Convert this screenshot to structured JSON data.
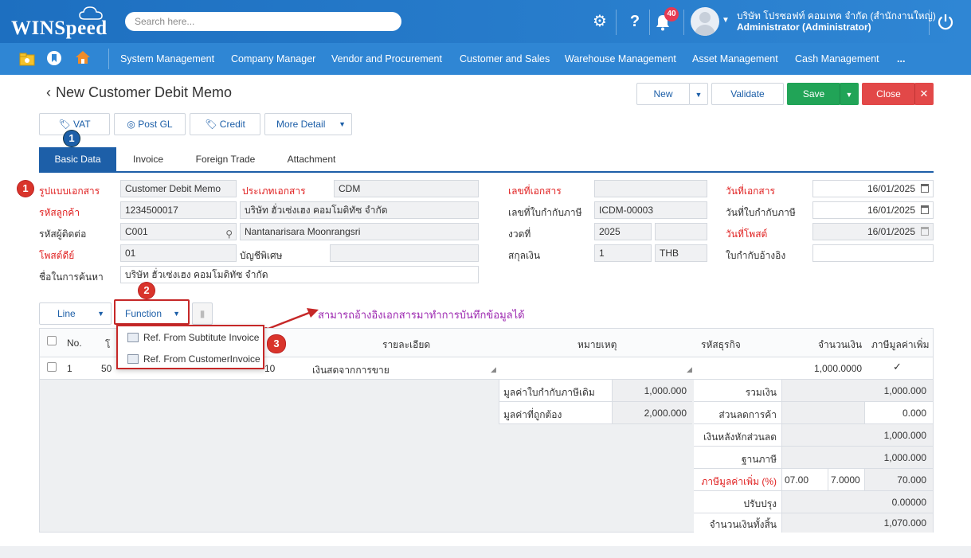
{
  "app": {
    "logo": "WINSpeed",
    "search_placeholder": "Search here...",
    "notifications_count": "40",
    "company": "บริษัท โปรซอฟท์ คอมเทค จำกัด (สำนักงานใหญ่)",
    "role": "Administrator (Administrator)"
  },
  "nav": {
    "items": [
      "System Management",
      "Company Manager",
      "Vendor and Procurement",
      "Customer and Sales",
      "Warehouse Management",
      "Asset Management",
      "Cash Management",
      "..."
    ]
  },
  "page": {
    "title": "New Customer Debit Memo",
    "back_icon": "chevron-left-icon"
  },
  "toolbar": {
    "new": "New",
    "validate": "Validate",
    "save": "Save",
    "close": "Close",
    "vat": "VAT",
    "post_gl": "Post GL",
    "credit": "Credit",
    "more_detail": "More Detail"
  },
  "tabs": [
    "Basic Data",
    "Invoice",
    "Foreign Trade",
    "Attachment"
  ],
  "form": {
    "doc_format_label": "รูปแบบเอกสาร",
    "doc_format_value": "Customer Debit Memo",
    "doc_type_label": "ประเภทเอกสาร",
    "doc_type_value": "CDM",
    "doc_no_label": "เลขที่เอกสาร",
    "doc_no_value": "",
    "doc_date_label": "วันที่เอกสาร",
    "doc_date_value": "16/01/2025",
    "customer_code_label": "รหัสลูกค้า",
    "customer_code_value": "1234500017",
    "customer_name_value": "บริษัท ฮั่วเซ่งเฮง คอมโมดิทัซ จำกัด",
    "tax_invoice_no_label": "เลขที่ใบกำกับภาษี",
    "tax_invoice_no_value": "ICDM-00003",
    "tax_invoice_date_label": "วันที่ใบกำกับภาษี",
    "tax_invoice_date_value": "16/01/2025",
    "contact_code_label": "รหัสผู้ติดต่อ",
    "contact_code_value": "C001",
    "contact_name_value": "Nantanarisara Moonrangsri",
    "period_label": "งวดที่",
    "period_value": "2025",
    "period_extra_value": "",
    "post_date_label": "วันที่โพสต์",
    "post_date_value": "16/01/2025",
    "post_book_label": "โพสต์ดีย์",
    "post_book_value": "01",
    "special_account_label": "บัญชีพิเศษ",
    "special_account_value": "",
    "currency_label": "สกุลเงิน",
    "currency_rate_value": "1",
    "currency_code_value": "THB",
    "ref_invoice_label": "ใบกำกับอ้างอิง",
    "ref_invoice_value": "",
    "search_name_label": "ชื่อในการค้นหา",
    "search_name_value": "บริษัท ฮั่วเซ่งเฮง คอมโมดิทัซ จำกัด"
  },
  "line_toolbar": {
    "line": "Line",
    "function": "Function",
    "menu": [
      "Ref. From Subtitute Invoice",
      "Ref. From CustomerInvoice"
    ]
  },
  "annotation": {
    "text": "สามารถอ้างอิงเอกสารมาทำการบันทึกข้อมูลได้",
    "badges": [
      "1",
      "1",
      "2",
      "3"
    ]
  },
  "grid": {
    "headers": [
      "No.",
      "โ",
      "รายละเอียด",
      "หมายเหตุ",
      "รหัสธุรกิจ",
      "จำนวนเงิน",
      "ภาษีมูลค่าเพิ่ม"
    ],
    "rows": [
      {
        "no": "1",
        "code": "50",
        "code_tail": "10",
        "detail": "เงินสดจากการขาย",
        "note": "",
        "biz": "",
        "amount": "1,000.0000",
        "vat": "✓"
      }
    ]
  },
  "summary_left": [
    {
      "label": "มูลค่าใบกำกับภาษีเดิม",
      "value": "1,000.000"
    },
    {
      "label": "มูลค่าที่ถูกต้อง",
      "value": "2,000.000"
    }
  ],
  "summary_right": [
    {
      "label": "รวมเงิน",
      "value": "1,000.000"
    },
    {
      "label": "ส่วนลดการค้า",
      "value": "0.000"
    },
    {
      "label": "เงินหลังหักส่วนลด",
      "value": "1,000.000"
    },
    {
      "label": "ฐานภาษี",
      "value": "1,000.000"
    },
    {
      "label": "ภาษีมูลค่าเพิ่ม (%)",
      "rate1": "07.00",
      "rate2": "7.0000",
      "value": "70.000"
    },
    {
      "label": "ปรับปรุง",
      "value": "0.00000"
    },
    {
      "label": "จำนวนเงินทั้งสิ้น",
      "value": "1,070.000"
    }
  ]
}
